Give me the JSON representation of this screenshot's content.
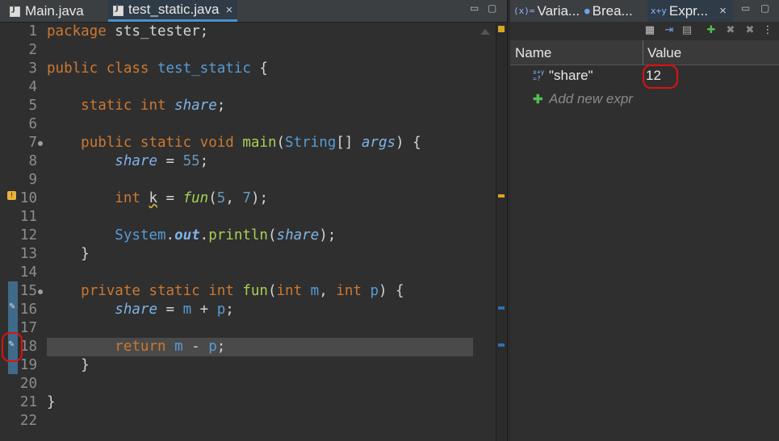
{
  "editor": {
    "tabs": [
      {
        "label": "Main.java",
        "active": false
      },
      {
        "label": "test_static.java",
        "active": true,
        "close": "×"
      }
    ],
    "minimize": "▭",
    "maximize": "▢",
    "lines": [
      {
        "n": "1",
        "code": [
          [
            "package ",
            "kw"
          ],
          [
            "sts_tester;",
            "pl"
          ]
        ]
      },
      {
        "n": "2",
        "code": []
      },
      {
        "n": "3",
        "code": [
          [
            "public class ",
            "kw"
          ],
          [
            "test_static",
            "ty"
          ],
          [
            " {",
            "pl"
          ]
        ]
      },
      {
        "n": "4",
        "code": []
      },
      {
        "n": "5",
        "code": [
          [
            "    ",
            "pl"
          ],
          [
            "static int ",
            "kw"
          ],
          [
            "share",
            "va"
          ],
          [
            ";",
            "pl"
          ]
        ]
      },
      {
        "n": "6",
        "code": []
      },
      {
        "n": "7",
        "fold": true,
        "code": [
          [
            "    ",
            "pl"
          ],
          [
            "public static void ",
            "kw"
          ],
          [
            "main",
            "fn"
          ],
          [
            "(",
            "pl"
          ],
          [
            "String",
            "ty"
          ],
          [
            "[] ",
            "pl"
          ],
          [
            "args",
            "va"
          ],
          [
            ") {",
            "pl"
          ]
        ]
      },
      {
        "n": "8",
        "code": [
          [
            "        ",
            "pl"
          ],
          [
            "share",
            "va"
          ],
          [
            " = ",
            "pl"
          ],
          [
            "55",
            "num"
          ],
          [
            ";",
            "pl"
          ]
        ]
      },
      {
        "n": "9",
        "code": []
      },
      {
        "n": "10",
        "code": [
          [
            "        ",
            "pl"
          ],
          [
            "int ",
            "kw"
          ],
          [
            "k",
            "squig"
          ],
          [
            " = ",
            "pl"
          ],
          [
            "fun",
            "fi"
          ],
          [
            "(",
            "pl"
          ],
          [
            "5",
            "num"
          ],
          [
            ", ",
            "pl"
          ],
          [
            "7",
            "num"
          ],
          [
            ");",
            "pl"
          ]
        ]
      },
      {
        "n": "11",
        "code": []
      },
      {
        "n": "12",
        "code": [
          [
            "        ",
            "pl"
          ],
          [
            "System",
            "ty"
          ],
          [
            ".",
            "pl"
          ],
          [
            "out",
            "vb"
          ],
          [
            ".",
            "pl"
          ],
          [
            "println",
            "fn"
          ],
          [
            "(",
            "pl"
          ],
          [
            "share",
            "va"
          ],
          [
            ");",
            "pl"
          ]
        ]
      },
      {
        "n": "13",
        "code": [
          [
            "    }",
            "pl"
          ]
        ]
      },
      {
        "n": "14",
        "code": []
      },
      {
        "n": "15",
        "fold": true,
        "code": [
          [
            "    ",
            "pl"
          ],
          [
            "private static int ",
            "kw"
          ],
          [
            "fun",
            "fn"
          ],
          [
            "(",
            "pl"
          ],
          [
            "int ",
            "kw"
          ],
          [
            "m",
            "ty"
          ],
          [
            ", ",
            "pl"
          ],
          [
            "int ",
            "kw"
          ],
          [
            "p",
            "ty"
          ],
          [
            ") {",
            "pl"
          ]
        ]
      },
      {
        "n": "16",
        "code": [
          [
            "        ",
            "pl"
          ],
          [
            "share",
            "va"
          ],
          [
            " = ",
            "pl"
          ],
          [
            "m",
            "ty"
          ],
          [
            " + ",
            "pl"
          ],
          [
            "p",
            "ty"
          ],
          [
            ";",
            "pl"
          ]
        ]
      },
      {
        "n": "17",
        "code": []
      },
      {
        "n": "18",
        "current": true,
        "code": [
          [
            "        ",
            "pl"
          ],
          [
            "return ",
            "kw"
          ],
          [
            "m",
            "ty"
          ],
          [
            " - ",
            "pl"
          ],
          [
            "p",
            "ty"
          ],
          [
            ";",
            "pl"
          ]
        ]
      },
      {
        "n": "19",
        "code": [
          [
            "    }",
            "pl"
          ]
        ]
      },
      {
        "n": "20",
        "code": []
      },
      {
        "n": "21",
        "code": [
          [
            "}",
            "pl"
          ]
        ]
      },
      {
        "n": "22",
        "code": []
      }
    ]
  },
  "panel": {
    "tabs": [
      {
        "label": "Varia...",
        "icon": "(x)="
      },
      {
        "label": "Brea...",
        "icon": "●"
      },
      {
        "label": "Expr...",
        "icon": "x+y",
        "active": true,
        "close": "×"
      }
    ],
    "minimize": "▭",
    "maximize": "▢",
    "columns": {
      "name": "Name",
      "value": "Value"
    },
    "expressions": [
      {
        "name": "\"share\"",
        "value": "12"
      }
    ],
    "add_placeholder": "Add new expr"
  },
  "colors": {
    "keyword": "#cc7832",
    "type": "#569cd6",
    "method": "#a9cf54",
    "field": "#7fb3e6",
    "annotation": "#e01010"
  }
}
